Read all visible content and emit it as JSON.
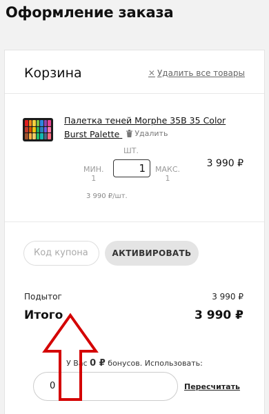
{
  "page": {
    "title": "Оформление заказа"
  },
  "cart": {
    "title": "Корзина",
    "clear_all_label": "Удалить все товары",
    "item": {
      "name": "Палетка теней Morphe 35B 35 Color Burst Palette",
      "remove_label": "Удалить",
      "qty_unit": "ШТ.",
      "qty_value": "1",
      "min_label": "МИН.",
      "min_value": "1",
      "max_label": "МАКС.",
      "max_value": "1",
      "line_price": "3 990 ₽",
      "unit_price": "3 990 ₽/шт."
    }
  },
  "coupon": {
    "placeholder": "Код купона",
    "activate_label": "АКТИВИРОВАТЬ"
  },
  "totals": {
    "subtotal_label": "Подытог",
    "subtotal_value": "3 990 ₽",
    "total_label": "Итого",
    "total_value": "3 990 ₽"
  },
  "bonus": {
    "prefix": "У Вас",
    "amount": "0 ₽",
    "suffix": "бонусов. Использовать:",
    "input_value": "0",
    "recalc_label": "Пересчитать"
  },
  "colors": {
    "arrow": "#d40000",
    "palette": [
      "#e02020",
      "#f08a1a",
      "#f4d03f",
      "#7bc043",
      "#2e86de",
      "#8e44ad",
      "#e84393",
      "#c0392b",
      "#d35400",
      "#f1c40f",
      "#27ae60",
      "#2980b9",
      "#6c5ce7",
      "#fd79a8",
      "#a0522d",
      "#ffb142",
      "#eccc68",
      "#20bf6b",
      "#0fb9b1",
      "#4b6584",
      "#ff6b81"
    ]
  }
}
